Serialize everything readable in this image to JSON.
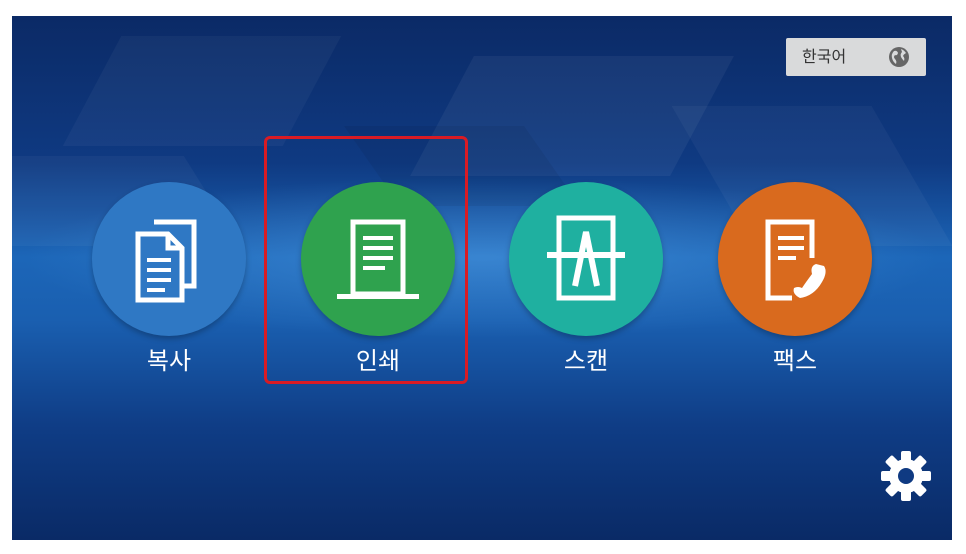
{
  "language": {
    "label": "한국어",
    "icon": "globe-icon"
  },
  "apps": [
    {
      "label": "복사",
      "icon": "copy-documents-icon",
      "color": "#2f78c4"
    },
    {
      "label": "인쇄",
      "icon": "print-document-icon",
      "color": "#2fa24e"
    },
    {
      "label": "스캔",
      "icon": "scan-icon",
      "color": "#1fb0a0"
    },
    {
      "label": "팩스",
      "icon": "fax-icon",
      "color": "#d96a1e"
    }
  ],
  "highlight_color": "#d91b24",
  "settings": {
    "icon": "gear-icon"
  }
}
